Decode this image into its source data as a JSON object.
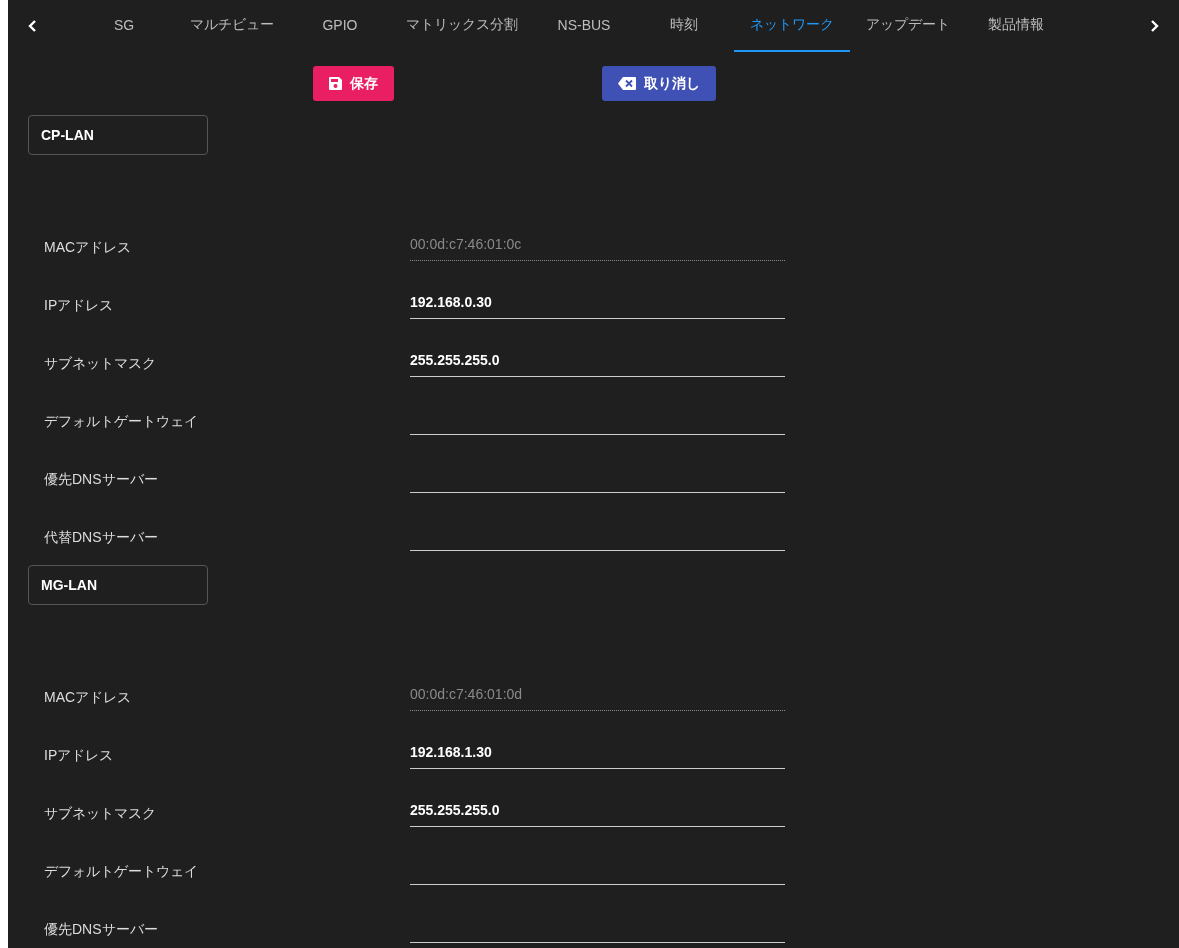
{
  "tabs": [
    {
      "label": "SG",
      "selected": false
    },
    {
      "label": "マルチビュー",
      "selected": false
    },
    {
      "label": "GPIO",
      "selected": false
    },
    {
      "label": "マトリックス分割",
      "selected": false
    },
    {
      "label": "NS-BUS",
      "selected": false
    },
    {
      "label": "時刻",
      "selected": false
    },
    {
      "label": "ネットワーク",
      "selected": true
    },
    {
      "label": "アップデート",
      "selected": false
    },
    {
      "label": "製品情報",
      "selected": false
    }
  ],
  "actions": [
    {
      "kind": "save",
      "label": "保存"
    },
    {
      "kind": "cancel",
      "label": "取り消し"
    }
  ],
  "sections": [
    {
      "title": "CP-LAN",
      "fields": [
        {
          "label": "MACアドレス",
          "value": "00:0d:c7:46:01:0c",
          "disabled": true
        },
        {
          "label": "IPアドレス",
          "value": "192.168.0.30",
          "disabled": false
        },
        {
          "label": "サブネットマスク",
          "value": "255.255.255.0",
          "disabled": false
        },
        {
          "label": "デフォルトゲートウェイ",
          "disabled": false
        },
        {
          "label": "優先DNSサーバー",
          "disabled": false
        },
        {
          "label": "代替DNSサーバー",
          "disabled": false
        }
      ]
    },
    {
      "title": "MG-LAN",
      "fields": [
        {
          "label": "MACアドレス",
          "value": "00:0d:c7:46:01:0d",
          "disabled": true
        },
        {
          "label": "IPアドレス",
          "value": "192.168.1.30",
          "disabled": false
        },
        {
          "label": "サブネットマスク",
          "value": "255.255.255.0",
          "disabled": false
        },
        {
          "label": "デフォルトゲートウェイ",
          "disabled": false
        },
        {
          "label": "優先DNSサーバー",
          "disabled": false
        }
      ]
    }
  ]
}
